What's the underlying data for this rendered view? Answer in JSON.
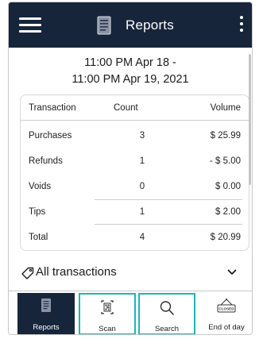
{
  "header": {
    "title": "Reports"
  },
  "report": {
    "date_line1": "11:00 PM Apr 18 -",
    "date_line2": "11:00 PM Apr 19, 2021"
  },
  "table": {
    "headers": [
      "Transaction",
      "Count",
      "Volume"
    ],
    "rows": [
      {
        "label": "Purchases",
        "count": "3",
        "volume": "$ 25.99"
      },
      {
        "label": "Refunds",
        "count": "1",
        "volume": "- $ 5.00"
      },
      {
        "label": "Voids",
        "count": "0",
        "volume": "$ 0.00"
      },
      {
        "label": "Tips",
        "count": "1",
        "volume": "$ 2.00"
      },
      {
        "label": "Total",
        "count": "4",
        "volume": "$ 20.99"
      }
    ]
  },
  "filter": {
    "label": "All transactions"
  },
  "bottom_nav": {
    "items": [
      {
        "label": "Reports",
        "icon": "report-doc-icon"
      },
      {
        "label": "Scan",
        "icon": "qr-scan-icon"
      },
      {
        "label": "Search",
        "icon": "magnifier-icon"
      },
      {
        "label": "End of day",
        "icon": "closed-sign-icon",
        "sign_text": "CLOSED"
      }
    ]
  },
  "colors": {
    "header_bg": "#17253b",
    "highlight_border": "#1eb6b6",
    "divider": "#cfcfcf"
  }
}
